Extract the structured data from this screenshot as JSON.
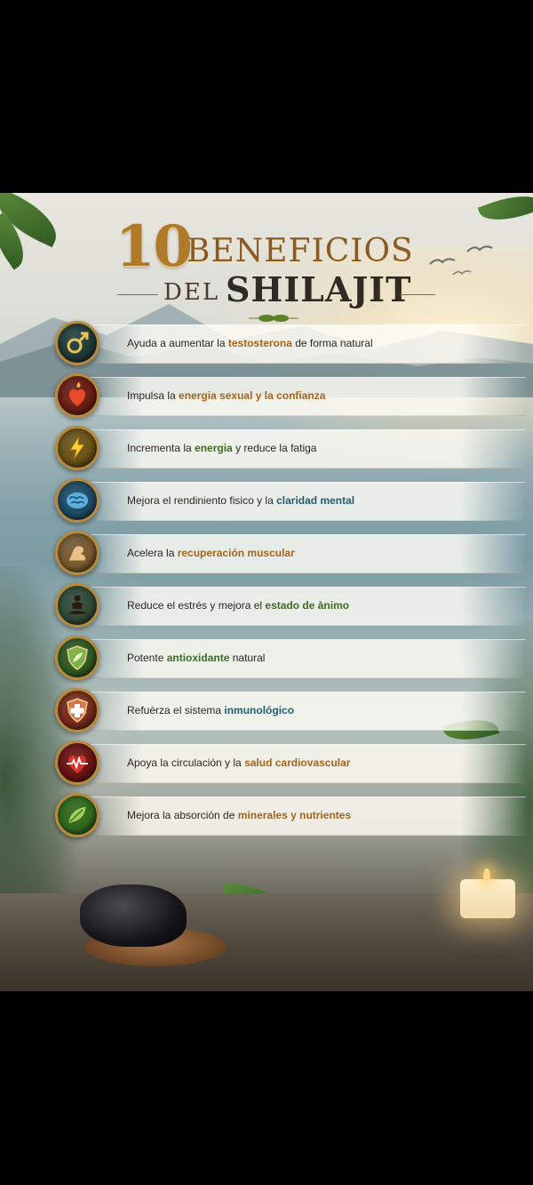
{
  "title": {
    "number": "10",
    "line1": "BENEFICIOS",
    "line2_small": "DEL",
    "line2_big": "SHILAJIT"
  },
  "colors": {
    "gold": "#b07a2a",
    "orange_highlight": "#a5641b",
    "green_highlight": "#3f6a24",
    "teal_highlight": "#1f5f73"
  },
  "benefits": [
    {
      "icon": "male-symbol-icon",
      "icon_bg": "#1e3b38",
      "prefix": "Ayuda a aumentar la ",
      "highlight": "testosterona",
      "highlight_color": "#a5641b",
      "suffix": " de forma natural"
    },
    {
      "icon": "flaming-heart-icon",
      "icon_bg": "#6b1d12",
      "prefix": "Impulsa la ",
      "highlight": "energia sexual y la confianza",
      "highlight_color": "#a5641b",
      "suffix": ""
    },
    {
      "icon": "lightning-bolt-icon",
      "icon_bg": "#6a5112",
      "prefix": "Incrementa la ",
      "highlight": "energia",
      "highlight_color": "#3f6a24",
      "suffix": " y reduce la fatiga"
    },
    {
      "icon": "brain-icon",
      "icon_bg": "#1d4a66",
      "prefix": "Mejora el rendiniento fisico y la ",
      "highlight": "claridad mental",
      "highlight_color": "#1f5f73",
      "suffix": ""
    },
    {
      "icon": "flexed-arm-icon",
      "icon_bg": "#7a5a2e",
      "prefix": "Acelera la ",
      "highlight": "recuperación muscular",
      "highlight_color": "#a5641b",
      "suffix": ""
    },
    {
      "icon": "meditation-icon",
      "icon_bg": "#2f4a36",
      "prefix": "Reduce el estrés y mejora el ",
      "highlight": "estado de ànimo",
      "highlight_color": "#3f6a24",
      "suffix": ""
    },
    {
      "icon": "shield-leaf-icon",
      "icon_bg": "#2f5a22",
      "prefix": "Potente ",
      "highlight": "antioxidante",
      "highlight_color": "#3f6a24",
      "suffix": " natural"
    },
    {
      "icon": "medical-shield-icon",
      "icon_bg": "#7a2a1a",
      "prefix": "Refuèrza el sistema ",
      "highlight": "inmunológico",
      "highlight_color": "#1f5f73",
      "suffix": ""
    },
    {
      "icon": "heartbeat-icon",
      "icon_bg": "#6b1212",
      "prefix": "Apoya la circulación y la ",
      "highlight": "salud cardiovascular",
      "highlight_color": "#a5641b",
      "suffix": ""
    },
    {
      "icon": "leaf-icon",
      "icon_bg": "#2f6a1c",
      "prefix": "Mejora la absorción de ",
      "highlight": "minerales y nutrientes",
      "highlight_color": "#a5641b",
      "suffix": ""
    }
  ]
}
